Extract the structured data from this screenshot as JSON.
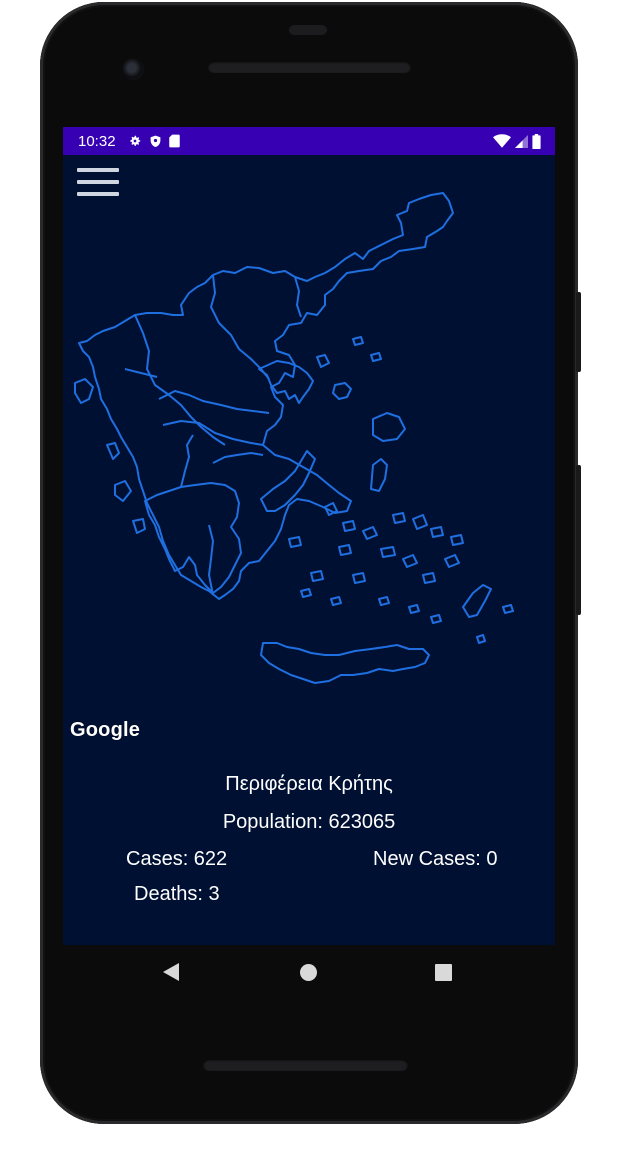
{
  "status_bar": {
    "time": "10:32",
    "left_icons": [
      "gear-icon",
      "shield-icon",
      "sd-card-icon"
    ],
    "right_icons": [
      "wifi-icon",
      "cell-signal-icon",
      "battery-icon"
    ],
    "color": "#3700b3"
  },
  "app": {
    "menu_icon": "hamburger-menu-icon",
    "map_background": "#001033",
    "border_color": "#1f6fe0",
    "map_logo": "Google"
  },
  "info": {
    "region": "Περιφέρεια Κρήτης",
    "population": "Population: 623065",
    "cases": "Cases: 622",
    "new_cases": "New Cases: 0",
    "deaths": "Deaths: 3"
  },
  "nav": {
    "back_icon": "back-triangle-icon",
    "home_icon": "home-circle-icon",
    "recents_icon": "recents-square-icon"
  }
}
